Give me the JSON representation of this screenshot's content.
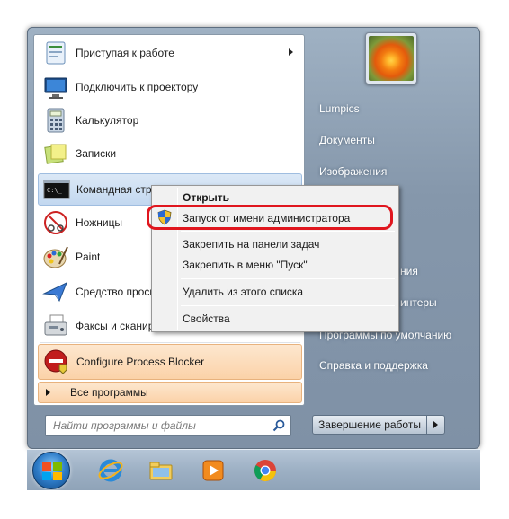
{
  "start_menu": {
    "programs": [
      {
        "label": "Приступая к работе",
        "icon": "getting-started-icon",
        "has_submenu": true
      },
      {
        "label": "Подключить к проектору",
        "icon": "projector-icon",
        "has_submenu": false
      },
      {
        "label": "Калькулятор",
        "icon": "calculator-icon",
        "has_submenu": false
      },
      {
        "label": "Записки",
        "icon": "sticky-notes-icon",
        "has_submenu": false
      },
      {
        "label": "Командная стро",
        "icon": "cmd-icon",
        "has_submenu": false
      },
      {
        "label": "Ножницы",
        "icon": "scissors-icon",
        "has_submenu": false
      },
      {
        "label": "Paint",
        "icon": "paint-icon",
        "has_submenu": false
      },
      {
        "label": "Средство просм",
        "icon": "viewer-icon",
        "has_submenu": false
      },
      {
        "label": "Факсы и сканир",
        "icon": "fax-icon",
        "has_submenu": false
      }
    ],
    "pinned": {
      "label": "Configure Process Blocker",
      "icon": "process-blocker-icon"
    },
    "all_programs": "Все программы",
    "search_placeholder": "Найти программы и файлы",
    "right_items": [
      "Lumpics",
      "Документы",
      "Изображения",
      "ния",
      "интеры",
      "Программы по умолчанию",
      "Справка и поддержка"
    ],
    "shutdown_label": "Завершение работы"
  },
  "context_menu": {
    "items": [
      {
        "label": "Открыть",
        "bold": true
      },
      {
        "label": "Запуск от имени администратора",
        "bold": false,
        "highlighted": true,
        "icon": "uac-shield-icon"
      },
      {
        "label": "Закрепить на панели задач",
        "bold": false
      },
      {
        "label": "Закрепить в меню \"Пуск\"",
        "bold": false
      },
      {
        "label": "Удалить из этого списка",
        "bold": false
      },
      {
        "label": "Свойства",
        "bold": false
      }
    ]
  },
  "taskbar": {
    "items": [
      "start-orb-icon",
      "internet-explorer-icon",
      "explorer-icon",
      "media-player-icon",
      "chrome-icon"
    ]
  },
  "colors": {
    "highlight_ring": "#e0161e",
    "hover_item": "#c3d8f0",
    "pinned_bg": "#fbd2a8"
  }
}
